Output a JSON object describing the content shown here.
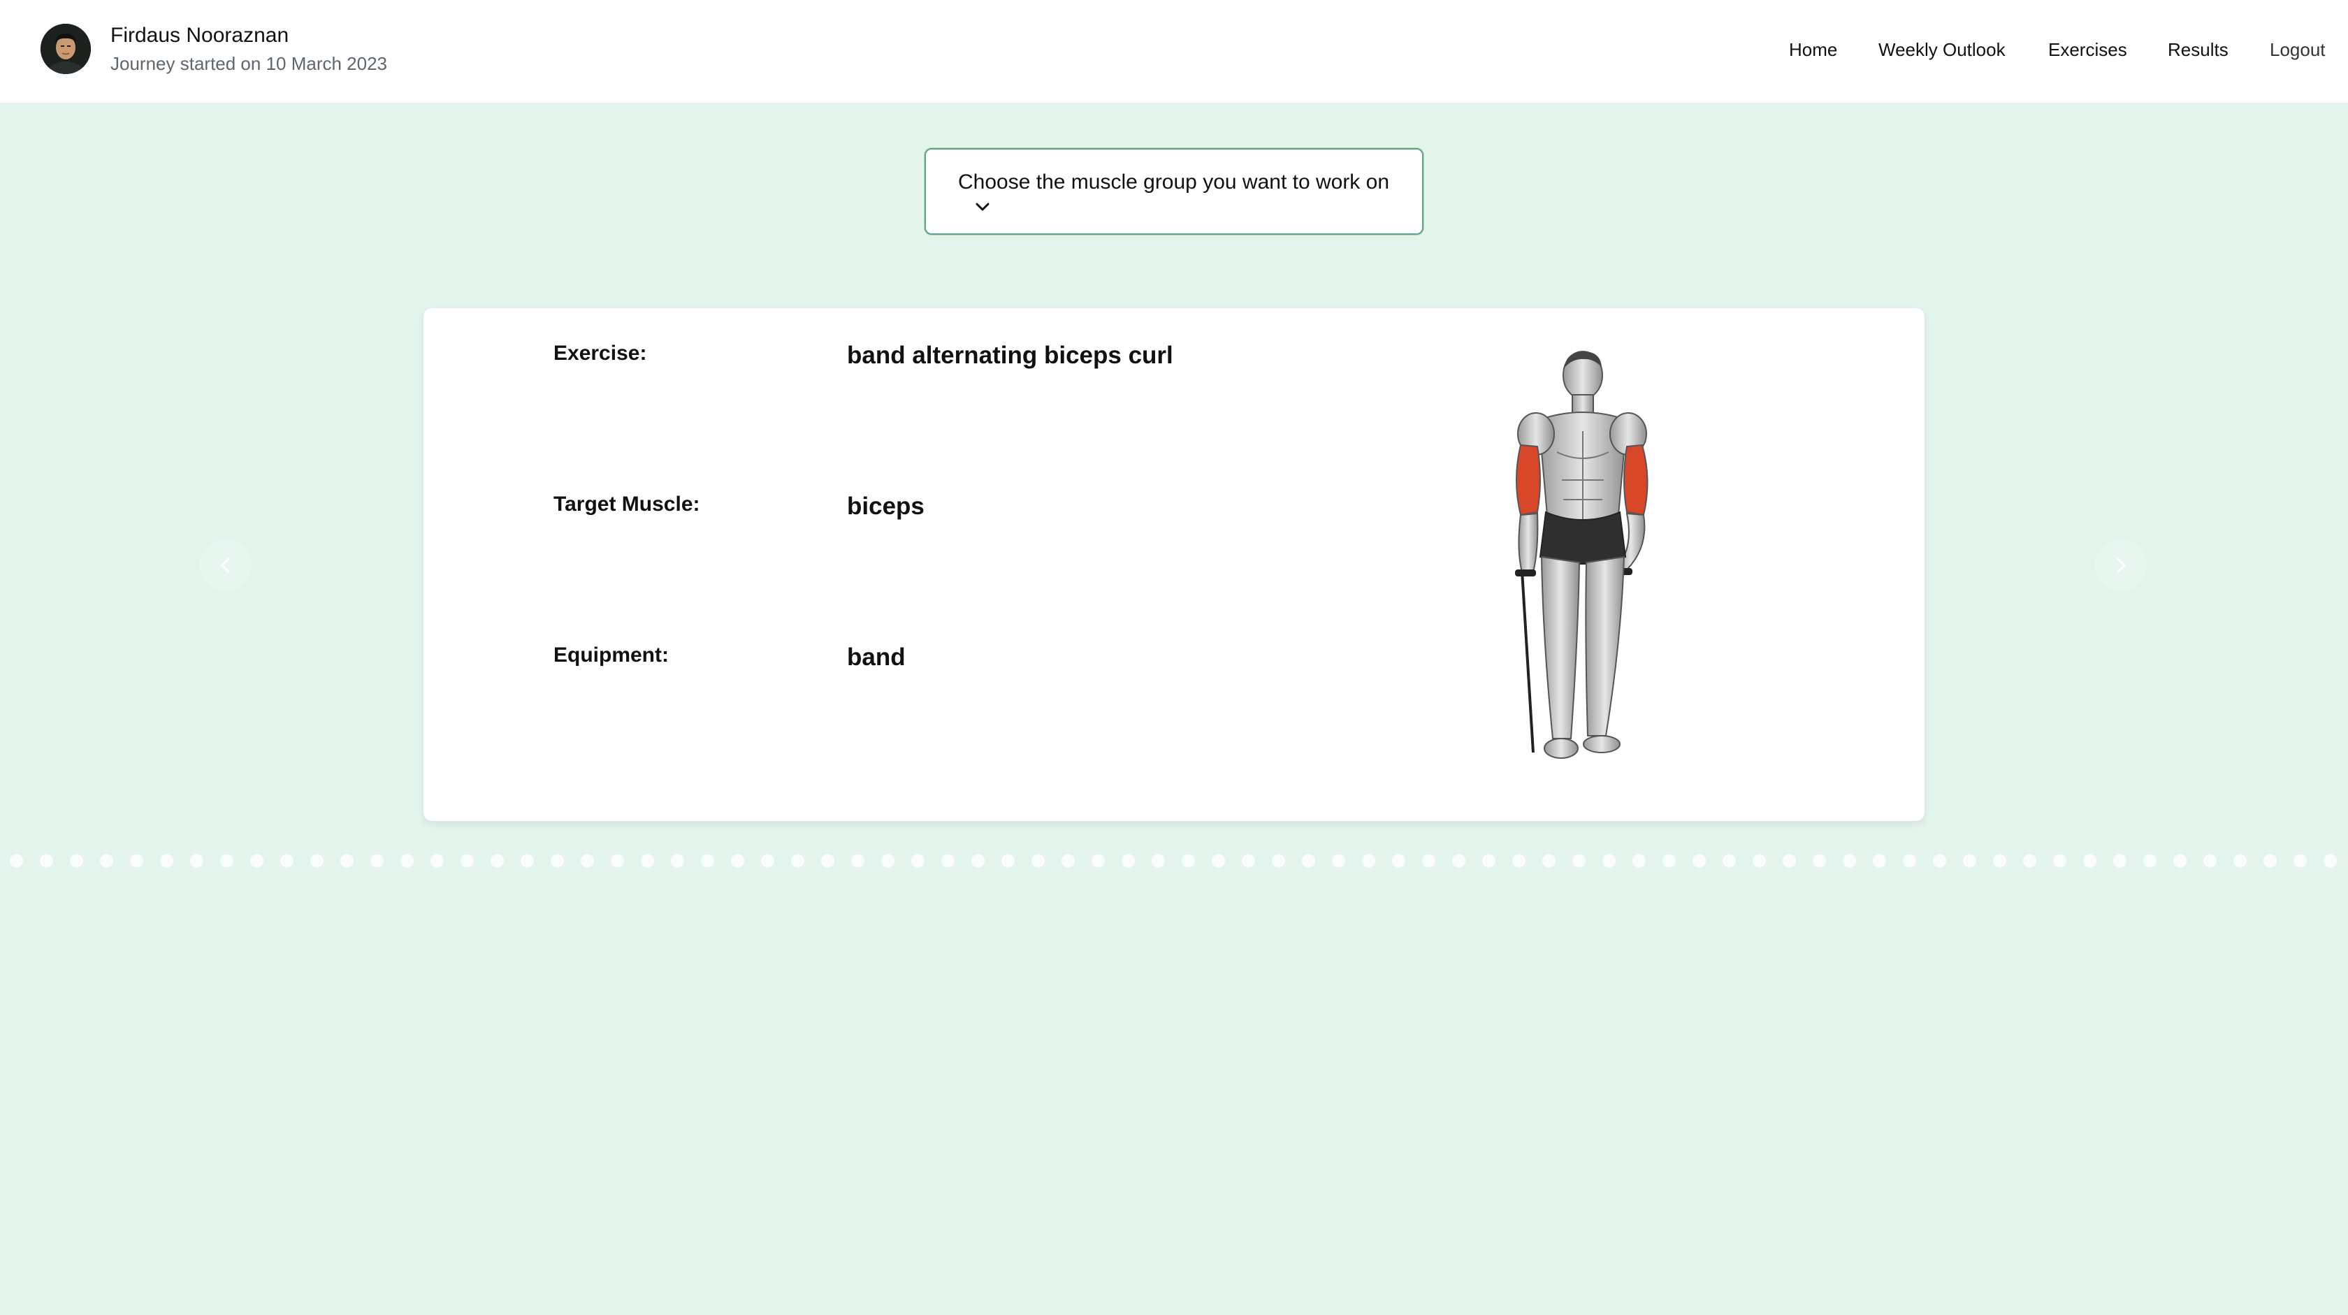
{
  "user": {
    "name": "Firdaus Nooraznan",
    "journey": "Journey started on 10 March 2023"
  },
  "nav": {
    "home": "Home",
    "weekly_outlook": "Weekly Outlook",
    "exercises": "Exercises",
    "results": "Results",
    "logout": "Logout"
  },
  "muscle_select": {
    "label": "Choose the muscle group you want to work on",
    "icon": "chevron-down-icon"
  },
  "exercise_card": {
    "exercise_label": "Exercise:",
    "exercise_value": "band alternating biceps curl",
    "target_label": "Target Muscle:",
    "target_value": "biceps",
    "equipment_label": "Equipment:",
    "equipment_value": "band",
    "highlight_color": "#d9472b"
  },
  "carousel": {
    "prev_icon": "chevron-left-icon",
    "next_icon": "chevron-right-icon"
  },
  "colors": {
    "background": "#e2f4ec",
    "card": "#ffffff",
    "header": "#ffffff"
  }
}
